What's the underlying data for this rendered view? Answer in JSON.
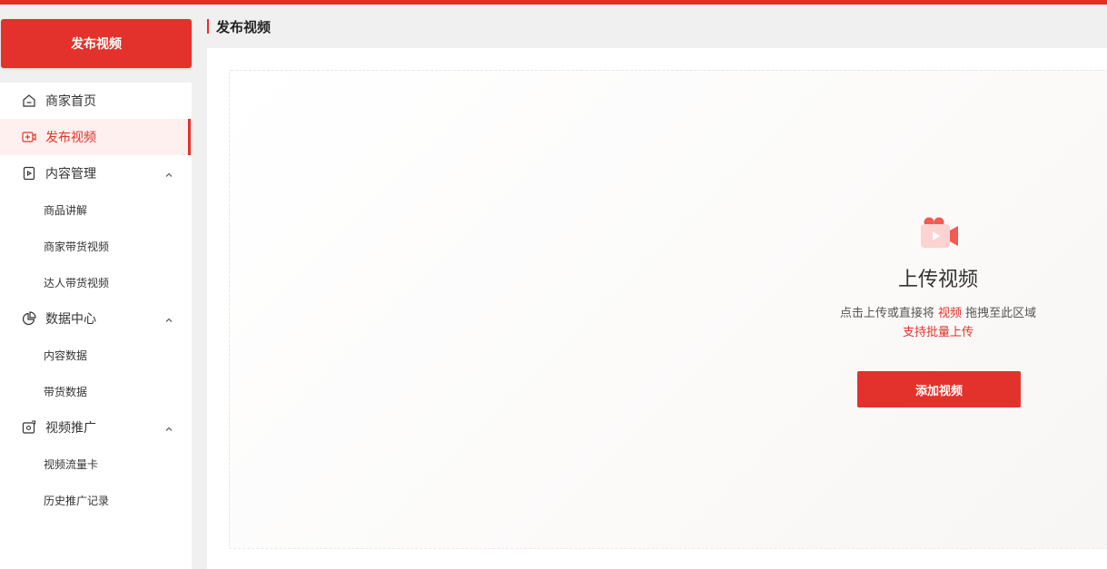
{
  "sidebar": {
    "publish_button": "发布视频",
    "items": [
      {
        "label": "商家首页",
        "icon": "home-icon"
      },
      {
        "label": "发布视频",
        "icon": "video-plus-icon",
        "active": true
      },
      {
        "label": "内容管理",
        "icon": "content-icon",
        "expanded": true,
        "children": [
          {
            "label": "商品讲解"
          },
          {
            "label": "商家带货视频"
          },
          {
            "label": "达人带货视频"
          }
        ]
      },
      {
        "label": "数据中心",
        "icon": "pie-chart-icon",
        "expanded": true,
        "children": [
          {
            "label": "内容数据"
          },
          {
            "label": "带货数据"
          }
        ]
      },
      {
        "label": "视频推广",
        "icon": "promote-icon",
        "expanded": true,
        "children": [
          {
            "label": "视频流量卡"
          },
          {
            "label": "历史推广记录"
          }
        ]
      }
    ]
  },
  "header": {
    "title": "发布视频"
  },
  "upload": {
    "icon": "video-camera-icon",
    "title": "上传视频",
    "hint_before": "点击上传或直接将",
    "hint_highlight": "视频",
    "hint_after": "拖拽至此区域",
    "batch_hint": "支持批量上传",
    "add_button": "添加视频"
  },
  "colors": {
    "accent": "#e3322b",
    "active_bg": "#fdf0ee"
  }
}
